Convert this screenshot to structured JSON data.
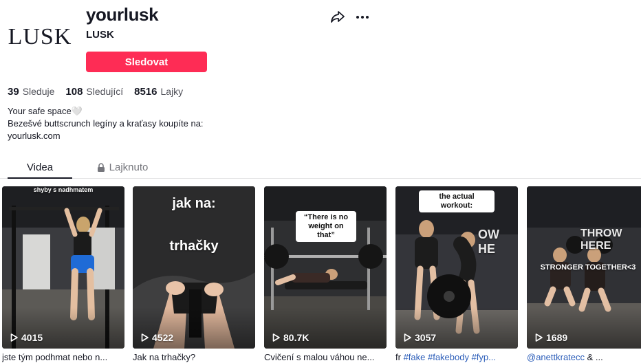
{
  "profile": {
    "avatar_logo": "LUSK",
    "username": "yourlusk",
    "nickname": "LUSK",
    "follow_label": "Sledovat",
    "share_icon": "share-arrow-icon",
    "more_icon": "more-dots-icon"
  },
  "stats": {
    "following_count": "39",
    "following_label": "Sleduje",
    "followers_count": "108",
    "followers_label": "Sledující",
    "likes_count": "8516",
    "likes_label": "Lajky"
  },
  "bio": {
    "line1": "Your safe space🤍",
    "line2": "Bezešvé buttscrunch legíny a kraťasy koupíte na:",
    "line3": "yourlusk.com"
  },
  "tabs": {
    "videos_label": "Videa",
    "liked_label": "Lajknuto"
  },
  "videos": [
    {
      "views": "4015",
      "caption": "jste tým podhmat nebo n...",
      "overlay": "shyby s nadhmatem"
    },
    {
      "views": "4522",
      "caption": "Jak na trhačky?",
      "overlay_line1": "jak na:",
      "overlay_line2": "trhačky"
    },
    {
      "views": "80.7K",
      "caption": "Cvičení s malou váhou ne...",
      "overlay": "“There is no weight on that”"
    },
    {
      "views": "3057",
      "caption_prefix": "fr ",
      "caption_tags": "#fake #fakebody #fyp...",
      "overlay": "the actual workout:",
      "wall_text": "OW HE"
    },
    {
      "views": "1689",
      "caption_mention": "@anettkratecc",
      "caption_suffix": " & ...",
      "overlay": "STRONGER TOGETHER<3",
      "wall_text": "THROW HERE"
    }
  ],
  "colors": {
    "accent": "#fe2c55",
    "text": "#161823",
    "secondary": "#75767c",
    "hashtag": "#2b5db9"
  }
}
